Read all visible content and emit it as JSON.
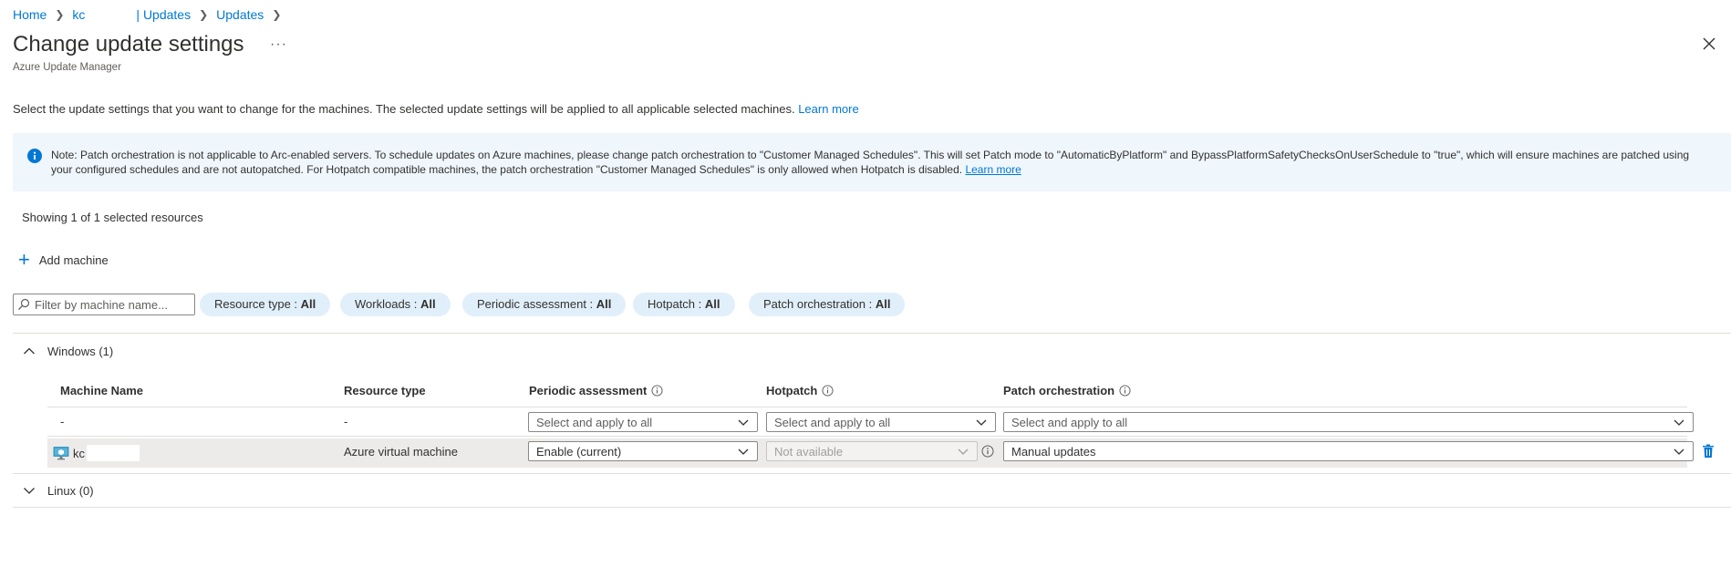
{
  "breadcrumb": {
    "home": "Home",
    "resource": "kc",
    "section": "| Updates",
    "current": "Updates"
  },
  "header": {
    "title": "Change update settings",
    "subtitle": "Azure Update Manager",
    "more": "···"
  },
  "description": {
    "text": "Select the update settings that you want to change for the machines. The selected update settings will be applied to all applicable selected machines.",
    "link": "Learn more"
  },
  "note": {
    "text": "Note: Patch orchestration is not applicable to Arc-enabled servers. To schedule updates on Azure machines, please change patch orchestration to \"Customer Managed Schedules\". This will set Patch mode to \"AutomaticByPlatform\" and BypassPlatformSafetyChecksOnUserSchedule to \"true\", which will ensure machines are patched using your configured schedules and are not autopatched. For Hotpatch compatible machines, the patch orchestration \"Customer Managed Schedules\" is only allowed when Hotpatch is disabled.",
    "link": "Learn more"
  },
  "showing": "Showing 1 of 1 selected resources",
  "add_machine": "Add machine",
  "filter": {
    "placeholder": "Filter by machine name..."
  },
  "pills": [
    {
      "label": "Resource type : ",
      "value": "All"
    },
    {
      "label": "Workloads : ",
      "value": "All"
    },
    {
      "label": "Periodic assessment : ",
      "value": "All"
    },
    {
      "label": "Hotpatch : ",
      "value": "All"
    },
    {
      "label": "Patch orchestration : ",
      "value": "All"
    }
  ],
  "groups": {
    "windows": "Windows (1)",
    "linux": "Linux (0)"
  },
  "columns": {
    "machine_name": "Machine Name",
    "resource_type": "Resource type",
    "periodic_assessment": "Periodic assessment",
    "hotpatch": "Hotpatch",
    "patch_orchestration": "Patch orchestration"
  },
  "apply_all_row": {
    "machine_name": "-",
    "resource_type": "-",
    "periodic_assessment": "Select and apply to all",
    "hotpatch": "Select and apply to all",
    "patch_orchestration": "Select and apply to all"
  },
  "machine_row": {
    "machine_name": "kc",
    "resource_type": "Azure virtual machine",
    "periodic_assessment": "Enable (current)",
    "hotpatch": "Not available",
    "patch_orchestration": "Manual updates"
  },
  "colors": {
    "accent": "#0078d4",
    "note_bg": "#eff6fc",
    "pill_bg": "#e1effa",
    "row_selected": "#edebe9"
  }
}
